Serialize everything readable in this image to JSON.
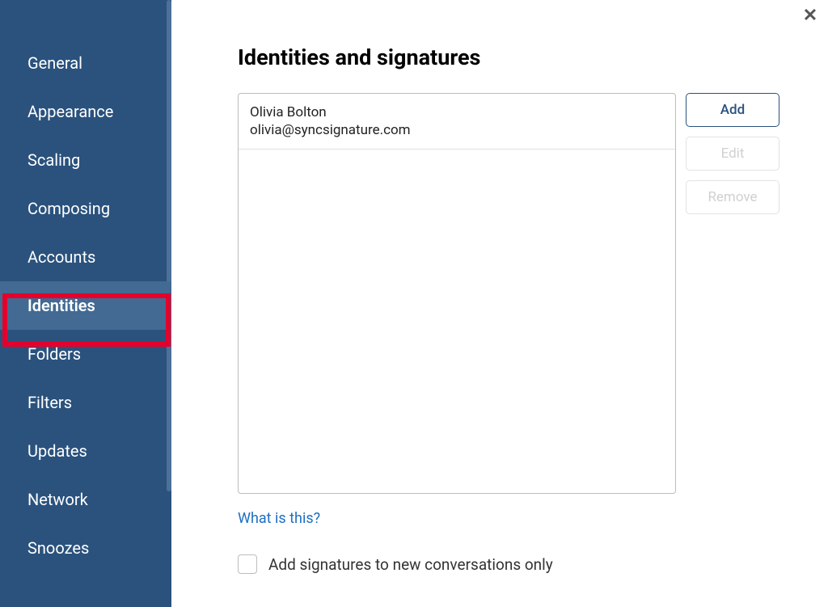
{
  "sidebar": {
    "items": [
      {
        "label": "General"
      },
      {
        "label": "Appearance"
      },
      {
        "label": "Scaling"
      },
      {
        "label": "Composing"
      },
      {
        "label": "Accounts"
      },
      {
        "label": "Identities"
      },
      {
        "label": "Folders"
      },
      {
        "label": "Filters"
      },
      {
        "label": "Updates"
      },
      {
        "label": "Network"
      },
      {
        "label": "Snoozes"
      }
    ],
    "active_index": 5
  },
  "main": {
    "title": "Identities and signatures",
    "identities": [
      {
        "name": "Olivia Bolton",
        "email": "olivia@syncsignature.com"
      }
    ],
    "buttons": {
      "add": "Add",
      "edit": "Edit",
      "remove": "Remove"
    },
    "help_link": "What is this?",
    "checkbox_label": "Add signatures to new conversations only"
  },
  "colors": {
    "sidebar_bg": "#2a527d",
    "sidebar_active_bg": "#426a93",
    "highlight_border": "#e4002b",
    "primary": "#2a527d",
    "link": "#1e6fc1"
  }
}
